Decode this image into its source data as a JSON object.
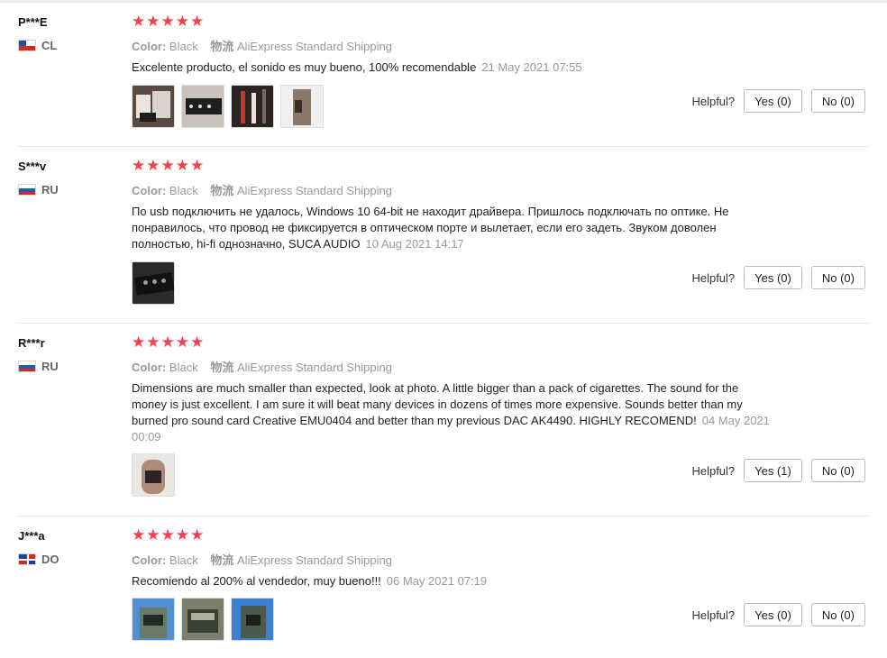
{
  "helpful_label": "Helpful?",
  "meta_labels": {
    "color_key": "Color:",
    "shipping_key": "物流"
  },
  "colors": {
    "star": "#f5414a",
    "meta_gray": "#999999"
  },
  "reviews": [
    {
      "author": "P***E",
      "country": "CL",
      "flag": "flag-cl-icon",
      "rating": 5,
      "color": "Black",
      "shipping": "AliExpress Standard Shipping",
      "text": "Excelente producto, el sonido es muy bueno, 100% recomendable",
      "date": "21 May 2021 07:55",
      "photos": 4,
      "yes": "Yes (0)",
      "no": "No (0)"
    },
    {
      "author": "S***v",
      "country": "RU",
      "flag": "flag-ru-icon",
      "rating": 5,
      "color": "Black",
      "shipping": "AliExpress Standard Shipping",
      "text": "По usb подключить не удалось, Windows 10 64-bit не находит драйвера. Пришлось подключать по оптике. Не понравилось, что провод не фиксируется в оптическом порте и вылетает, если его задеть. Звуком доволен полностью, hi-fi однозначно, SUCA AUDIO",
      "date": "10 Aug 2021 14:17",
      "photos": 1,
      "yes": "Yes (0)",
      "no": "No (0)"
    },
    {
      "author": "R***r",
      "country": "RU",
      "flag": "flag-ru-icon",
      "rating": 5,
      "color": "Black",
      "shipping": "AliExpress Standard Shipping",
      "text": "Dimensions are much smaller than expected, look at photo. A little bigger than a pack of cigarettes. The sound for the money is just excellent. I am sure it will beat many devices in dozens of times more expensive. Sounds better than my burned pro sound card Creative EMU0404 and better than my previous DAC AK4490. HIGHLY RECOMEND!",
      "date": "04 May 2021 00:09",
      "photos": 1,
      "yes": "Yes (1)",
      "no": "No (0)"
    },
    {
      "author": "J***a",
      "country": "DO",
      "flag": "flag-do-icon",
      "rating": 5,
      "color": "Black",
      "shipping": "AliExpress Standard Shipping",
      "text": "Recomiendo al 200% al vendedor, muy bueno!!!",
      "date": "06 May 2021 07:19",
      "photos": 3,
      "yes": "Yes (0)",
      "no": "No (0)"
    }
  ]
}
